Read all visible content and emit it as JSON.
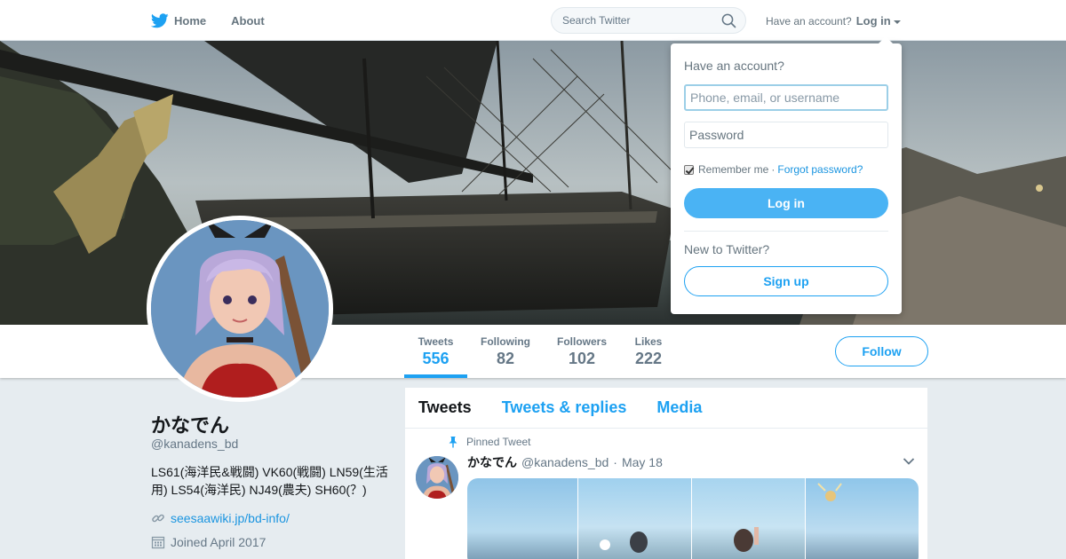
{
  "nav": {
    "home_label": "Home",
    "about_label": "About",
    "search_placeholder": "Search Twitter",
    "have_account": "Have an account?",
    "login_label": "Log in"
  },
  "profile": {
    "name": "かなでん",
    "handle": "@kanadens_bd",
    "bio": "LS61(海洋民&戦闘) VK60(戦闘) LN59(生活用) LS54(海洋民) NJ49(農夫) SH60(？)",
    "link": "seesaawiki.jp/bd-info/",
    "joined": "Joined April 2017"
  },
  "stats": [
    {
      "label": "Tweets",
      "value": "556"
    },
    {
      "label": "Following",
      "value": "82"
    },
    {
      "label": "Followers",
      "value": "102"
    },
    {
      "label": "Likes",
      "value": "222"
    }
  ],
  "follow_label": "Follow",
  "timeline": {
    "tabs": [
      "Tweets",
      "Tweets & replies",
      "Media"
    ],
    "pinned_label": "Pinned Tweet",
    "tweet": {
      "name": "かなでん",
      "handle": "@kanadens_bd",
      "separator": "·",
      "date": "May 18"
    }
  },
  "login_dropdown": {
    "title": "Have an account?",
    "username_placeholder": "Phone, email, or username",
    "password_placeholder": "Password",
    "remember_label": "Remember me",
    "separator": "·",
    "forgot_label": "Forgot password?",
    "login_button": "Log in",
    "new_to": "New to Twitter?",
    "signup_button": "Sign up",
    "remember_checked": true
  },
  "colors": {
    "accent": "#1da1f2",
    "login_button": "#4ab3f4",
    "link": "#1b95e0",
    "background": "#e6ecf0"
  },
  "icons": [
    "twitter-bird-icon",
    "search-icon",
    "pin-icon",
    "link-icon",
    "calendar-icon",
    "chevron-down-icon"
  ]
}
